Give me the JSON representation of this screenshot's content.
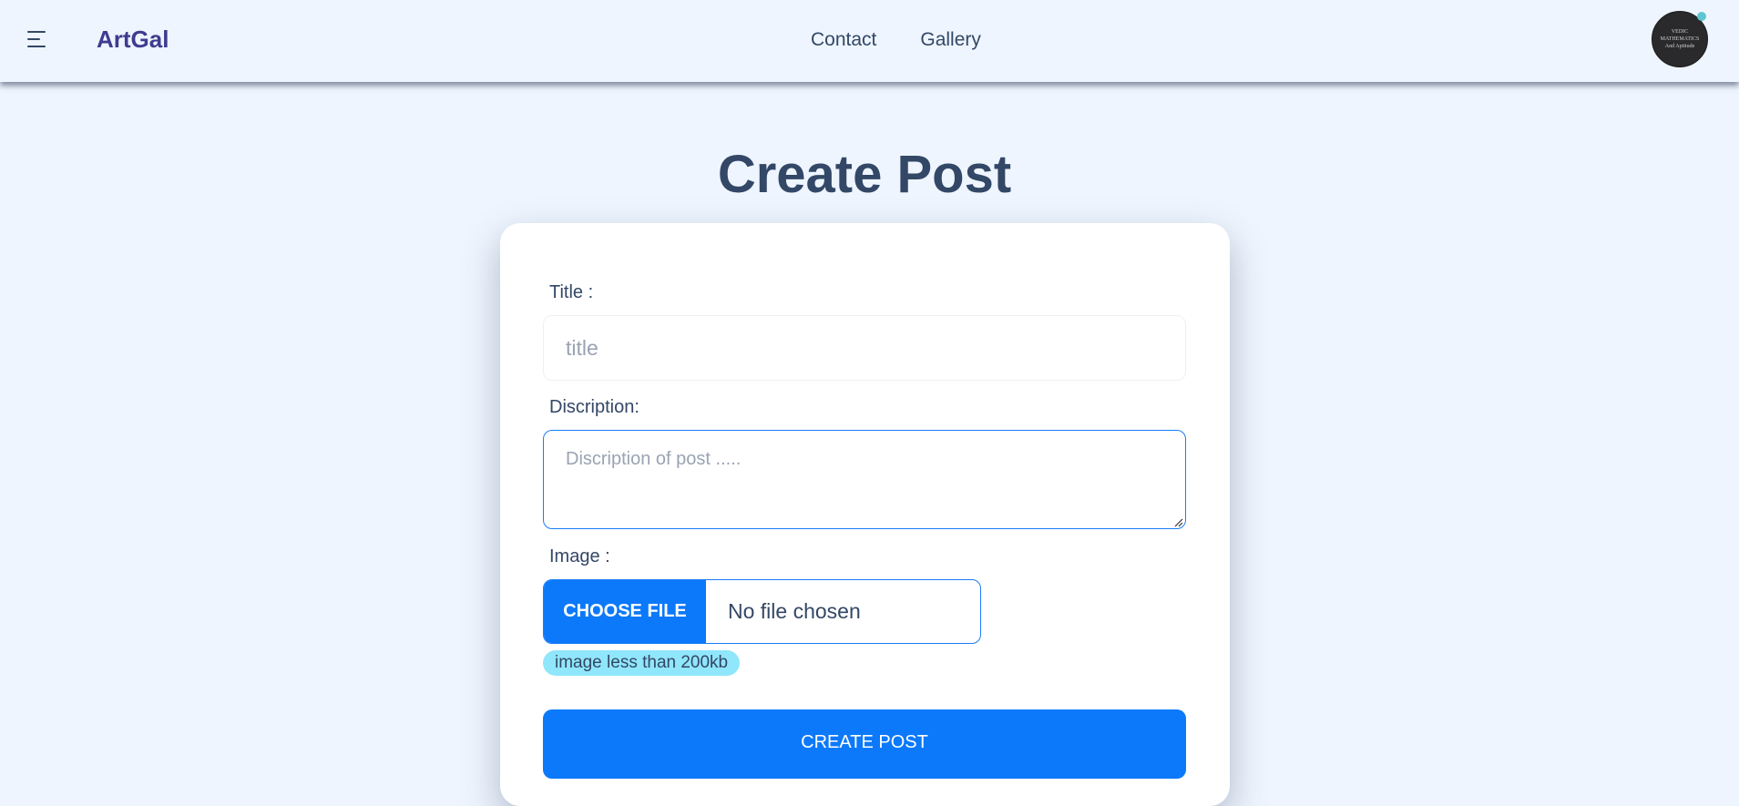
{
  "nav": {
    "brand": "ArtGal",
    "links": [
      "Contact",
      "Gallery"
    ],
    "avatar_lines": [
      "VEDIC",
      "MATHEMATICS",
      "And Aptitude"
    ]
  },
  "page": {
    "title": "Create Post"
  },
  "form": {
    "title_label": "Title :",
    "title_placeholder": "title",
    "description_label": "Discription:",
    "description_placeholder": "Discription of post .....",
    "image_label": "Image :",
    "choose_file_label": "CHOOSE FILE",
    "file_status": "No file chosen",
    "image_hint": "image less than 200kb",
    "submit_label": "CREATE POST"
  },
  "colors": {
    "background": "#eef5fe",
    "brand": "#3e3c8f",
    "primary": "#0c79fa",
    "text": "#334766",
    "hint_badge": "#90e6fb",
    "status_dot": "#5cc6d1"
  },
  "icons": [
    "menu-icon",
    "resize-grip-icon"
  ]
}
